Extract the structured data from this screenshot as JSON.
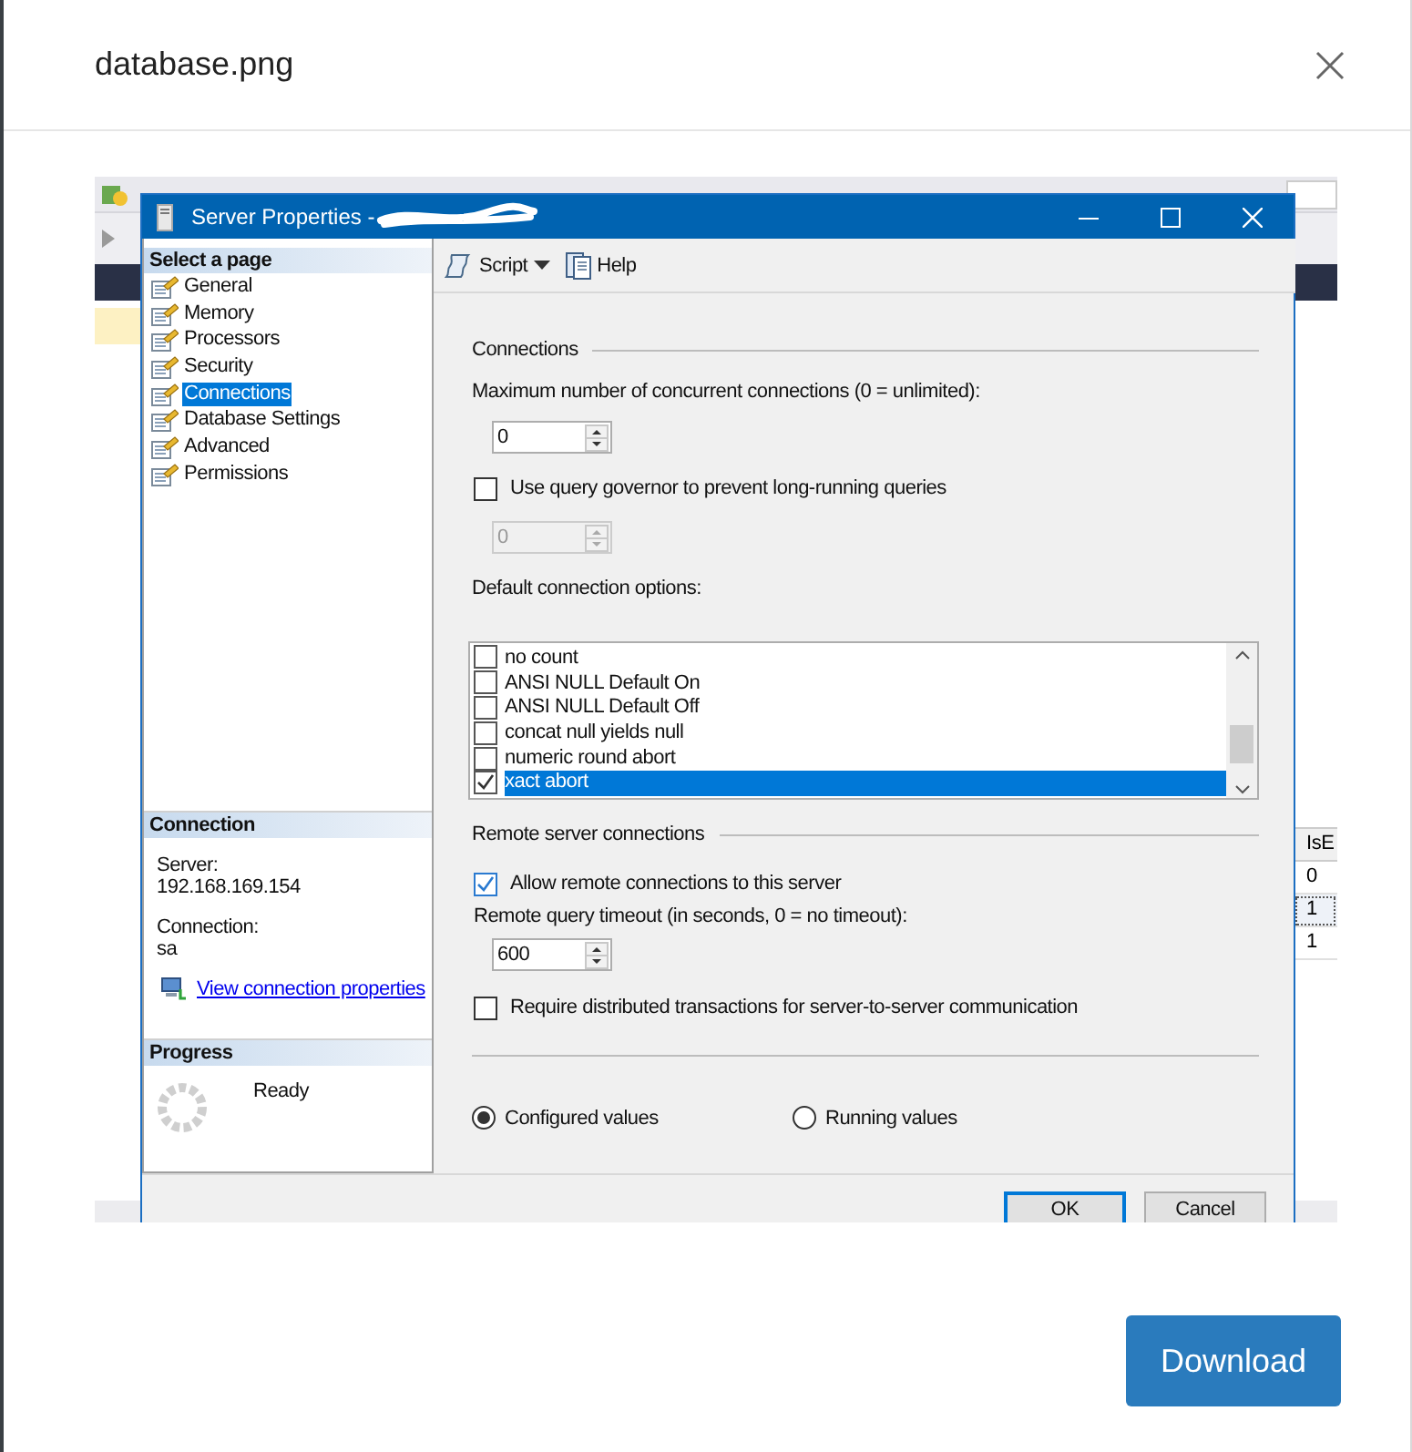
{
  "modal": {
    "title": "database.png",
    "download_button": "Download"
  },
  "screenshot": {
    "background_grid": {
      "header": "IsE",
      "rows": [
        {
          "value": "0",
          "selected": false
        },
        {
          "value": "1",
          "selected": true
        },
        {
          "value": "1",
          "selected": false
        }
      ]
    },
    "dialog": {
      "title": "Server Properties -",
      "toolbar": [
        {
          "label": "Script",
          "kind": "dropdown"
        },
        {
          "label": "Help",
          "kind": "help"
        }
      ],
      "pages_header": "Select a page",
      "pages": [
        {
          "label": "General",
          "selected": false
        },
        {
          "label": "Memory",
          "selected": false
        },
        {
          "label": "Processors",
          "selected": false
        },
        {
          "label": "Security",
          "selected": false
        },
        {
          "label": "Connections",
          "selected": true
        },
        {
          "label": "Database Settings",
          "selected": false
        },
        {
          "label": "Advanced",
          "selected": false
        },
        {
          "label": "Permissions",
          "selected": false
        }
      ],
      "connection": {
        "header": "Connection",
        "fields": [
          {
            "label": "Server:",
            "value": "192.168.169.154"
          },
          {
            "label": "Connection:",
            "value": "sa"
          }
        ],
        "link": "View connection properties"
      },
      "progress": {
        "header": "Progress",
        "status": "Ready"
      },
      "connections_group": {
        "title": "Connections",
        "max_label": "Maximum number of concurrent connections (0 = unlimited):",
        "max_value": {
          "value": "0",
          "disabled": false
        },
        "governor": {
          "label": "Use query governor to prevent long-running queries",
          "checked": false
        },
        "governor_value": {
          "value": "0",
          "disabled": true
        },
        "options_label": "Default connection options:",
        "options": [
          {
            "label": "no count",
            "checked": false,
            "selected": false
          },
          {
            "label": "ANSI NULL Default On",
            "checked": false,
            "selected": false
          },
          {
            "label": "ANSI NULL Default Off",
            "checked": false,
            "selected": false
          },
          {
            "label": "concat null yields null",
            "checked": false,
            "selected": false
          },
          {
            "label": "numeric round abort",
            "checked": false,
            "selected": false
          },
          {
            "label": "xact abort",
            "checked": true,
            "selected": true
          }
        ]
      },
      "remote_group": {
        "title": "Remote server connections",
        "allow": {
          "label": "Allow remote connections to this server",
          "checked": true
        },
        "timeout_label": "Remote query timeout (in seconds, 0 = no timeout):",
        "timeout_value": {
          "value": "600",
          "disabled": false
        },
        "require": {
          "label": "Require distributed transactions for server-to-server communication",
          "checked": false
        }
      },
      "value_modes": [
        {
          "label": "Configured values",
          "selected": true
        },
        {
          "label": "Running values",
          "selected": false
        }
      ],
      "buttons": [
        {
          "label": "OK",
          "default": true
        },
        {
          "label": "Cancel",
          "default": false
        }
      ]
    }
  }
}
